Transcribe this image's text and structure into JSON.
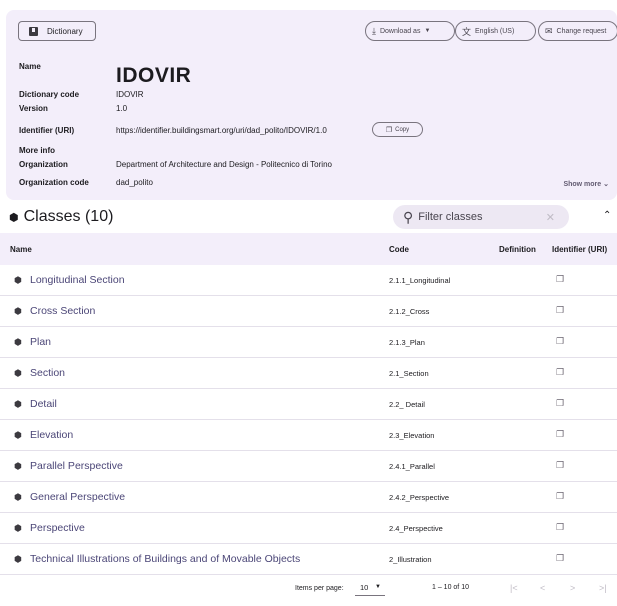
{
  "header": {
    "dictionary_button": "Dictionary",
    "download_label": "Download as",
    "language_label": "English (US)",
    "change_request_label": "Change request"
  },
  "details": {
    "name_label": "Name",
    "name_value": "IDOVIR",
    "code_label": "Dictionary code",
    "code_value": "IDOVIR",
    "version_label": "Version",
    "version_value": "1.0",
    "uri_label": "Identifier (URI)",
    "uri_value": "https://identifier.buildingsmart.org/uri/dad_polito/IDOVIR/1.0",
    "copy_label": "Copy",
    "more_info_label": "More info",
    "org_label": "Organization",
    "org_value": "Department of Architecture and Design - Politecnico di Torino",
    "org_code_label": "Organization code",
    "org_code_value": "dad_polito",
    "show_more_label": "Show more"
  },
  "classes": {
    "title": "Classes (10)",
    "filter_placeholder": "Filter classes",
    "columns": {
      "name": "Name",
      "code": "Code",
      "definition": "Definition",
      "uri": "Identifier (URI)"
    },
    "rows": [
      {
        "name": "Longitudinal Section",
        "code": "2.1.1_Longitudinal"
      },
      {
        "name": "Cross Section",
        "code": "2.1.2_Cross"
      },
      {
        "name": "Plan",
        "code": "2.1.3_Plan"
      },
      {
        "name": "Section",
        "code": "2.1_Section"
      },
      {
        "name": "Detail",
        "code": "2.2_ Detail"
      },
      {
        "name": "Elevation",
        "code": "2.3_Elevation"
      },
      {
        "name": "Parallel Perspective",
        "code": "2.4.1_Parallel"
      },
      {
        "name": "General Perspective",
        "code": "2.4.2_Perspective"
      },
      {
        "name": "Perspective",
        "code": "2.4_Perspective"
      },
      {
        "name": "Technical Illustrations of Buildings and of Movable Objects",
        "code": "2_Illustration"
      }
    ]
  },
  "pagination": {
    "items_per_page_label": "Items per page:",
    "items_per_page_value": "10",
    "range": "1 – 10 of 10"
  },
  "icons": [
    "book-icon",
    "download-icon",
    "translate-icon",
    "mail-icon",
    "copy-icon",
    "cube-icon",
    "search-icon",
    "clear-icon",
    "collapse-icon"
  ]
}
